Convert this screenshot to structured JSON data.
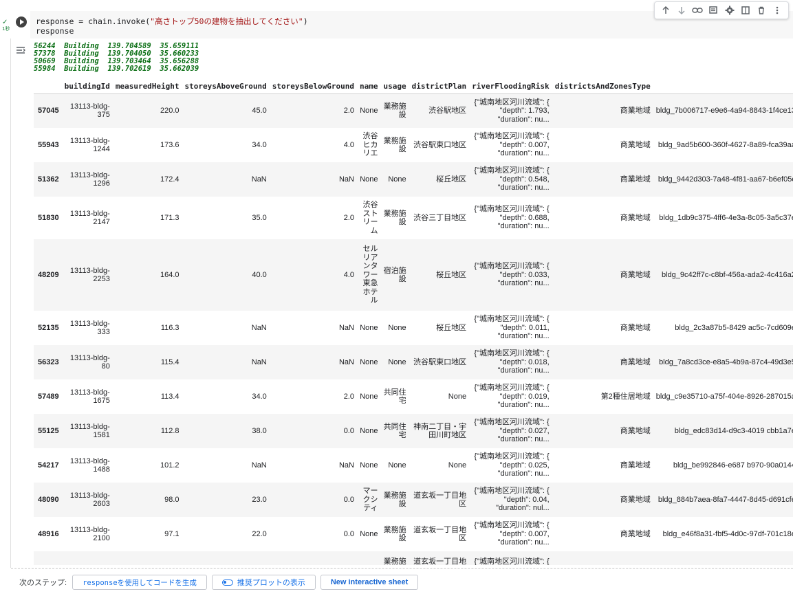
{
  "cell": {
    "status_check": "✓",
    "elapsed": "1秒",
    "code_prefix": "response = chain.invoke(",
    "code_string": "\"高さトップ50の建物を抽出してください\"",
    "code_suffix": ")",
    "code_line2": "response"
  },
  "toolbar": {
    "icons": [
      "arrow-up-icon",
      "arrow-down-icon",
      "link-icon",
      "comment-icon",
      "gear-icon",
      "mirror-icon",
      "trash-icon",
      "more-vert-icon"
    ]
  },
  "log_lines": [
    "56244  Building  139.704589  35.659111",
    "57378  Building  139.704050  35.660233",
    "50669  Building  139.703464  35.656288",
    "55984  Building  139.702619  35.662039"
  ],
  "table": {
    "columns": [
      "",
      "buildingId",
      "measuredHeight",
      "storeysAboveGround",
      "storeysBelowGround",
      "name",
      "usage",
      "districtPlan",
      "riverFloodingRisk",
      "districtsAndZonesType",
      ""
    ],
    "rows": [
      {
        "idx": "57045",
        "bid": "13113-bldg-375",
        "h": "220.0",
        "above": "45.0",
        "below": "2.0",
        "name": "None",
        "usage": "業務施設",
        "dp": "渋谷駅地区",
        "risk": "{\"城南地区河川流域\": { \"depth\": 1.793, \"duration\": nu...",
        "zone": "商業地域",
        "gml": "bldg_7b006717-e9e6-4a94-8843-1f4ce13"
      },
      {
        "idx": "55943",
        "bid": "13113-bldg-1244",
        "h": "173.6",
        "above": "34.0",
        "below": "4.0",
        "name": "渋谷ヒカリエ",
        "usage": "業務施設",
        "dp": "渋谷駅東口地区",
        "risk": "{\"城南地区河川流域\": { \"depth\": 0.007, \"duration\": nu...",
        "zone": "商業地域",
        "gml": "bldg_9ad5b600-360f-4627-8a89-fca39aa"
      },
      {
        "idx": "51362",
        "bid": "13113-bldg-1296",
        "h": "172.4",
        "above": "NaN",
        "below": "NaN",
        "name": "None",
        "usage": "None",
        "dp": "桜丘地区",
        "risk": "{\"城南地区河川流域\": { \"depth\": 0.548, \"duration\": nu...",
        "zone": "商業地域",
        "gml": "bldg_9442d303-7a48-4f81-aa67-b6ef05c"
      },
      {
        "idx": "51830",
        "bid": "13113-bldg-2147",
        "h": "171.3",
        "above": "35.0",
        "below": "2.0",
        "name": "渋谷ストリーム",
        "usage": "業務施設",
        "dp": "渋谷三丁目地区",
        "risk": "{\"城南地区河川流域\": { \"depth\": 0.688, \"duration\": nu...",
        "zone": "商業地域",
        "gml": "bldg_1db9c375-4ff6-4e3a-8c05-3a5c37e"
      },
      {
        "idx": "48209",
        "bid": "13113-bldg-2253",
        "h": "164.0",
        "above": "40.0",
        "below": "4.0",
        "name": "セルリアンタワー東急ホテル",
        "usage": "宿泊施設",
        "dp": "桜丘地区",
        "risk": "{\"城南地区河川流域\": { \"depth\": 0.033, \"duration\": nu...",
        "zone": "商業地域",
        "gml": "bldg_9c42ff7c-c8bf-456a-ada2-4c416a2"
      },
      {
        "idx": "52135",
        "bid": "13113-bldg-333",
        "h": "116.3",
        "above": "NaN",
        "below": "NaN",
        "name": "None",
        "usage": "None",
        "dp": "桜丘地区",
        "risk": "{\"城南地区河川流域\": { \"depth\": 0.011, \"duration\": nu...",
        "zone": "商業地域",
        "gml": "bldg_2c3a87b5-8429 ac5c-7cd609e"
      },
      {
        "idx": "56323",
        "bid": "13113-bldg-80",
        "h": "115.4",
        "above": "NaN",
        "below": "NaN",
        "name": "None",
        "usage": "None",
        "dp": "渋谷駅東口地区",
        "risk": "{\"城南地区河川流域\": { \"depth\": 0.018, \"duration\": nu...",
        "zone": "商業地域",
        "gml": "bldg_7a8cd3ce-e8a5-4b9a-87c4-49d3e5"
      },
      {
        "idx": "57489",
        "bid": "13113-bldg-1675",
        "h": "113.4",
        "above": "34.0",
        "below": "2.0",
        "name": "None",
        "usage": "共同住宅",
        "dp": "None",
        "risk": "{\"城南地区河川流域\": { \"depth\": 0.019, \"duration\": nu...",
        "zone": "第2種住居地域",
        "gml": "bldg_c9e35710-a75f-404e-8926-287015a"
      },
      {
        "idx": "55125",
        "bid": "13113-bldg-1581",
        "h": "112.8",
        "above": "38.0",
        "below": "0.0",
        "name": "None",
        "usage": "共同住宅",
        "dp": "神南二丁目・宇田川町地区",
        "risk": "{\"城南地区河川流域\": { \"depth\": 0.027, \"duration\": nu...",
        "zone": "商業地域",
        "gml": "bldg_edc83d14-d9c3-4019 cbb1a7e"
      },
      {
        "idx": "54217",
        "bid": "13113-bldg-1488",
        "h": "101.2",
        "above": "NaN",
        "below": "NaN",
        "name": "None",
        "usage": "None",
        "dp": "None",
        "risk": "{\"城南地区河川流域\": { \"depth\": 0.025, \"duration\": nu...",
        "zone": "商業地域",
        "gml": "bldg_be992846-e687 b970-90a0144"
      },
      {
        "idx": "48090",
        "bid": "13113-bldg-2603",
        "h": "98.0",
        "above": "23.0",
        "below": "0.0",
        "name": "マークシティ",
        "usage": "業務施設",
        "dp": "道玄坂一丁目地区",
        "risk": "{\"城南地区河川流域\": { \"depth\": 0.04, \"duration\": nul...",
        "zone": "商業地域",
        "gml": "bldg_884b7aea-8fa7-4447-8d45-d691cfe"
      },
      {
        "idx": "48916",
        "bid": "13113-bldg-2100",
        "h": "97.1",
        "above": "22.0",
        "below": "0.0",
        "name": "None",
        "usage": "業務施設",
        "dp": "道玄坂一丁目地区",
        "risk": "{\"城南地区河川流域\": { \"depth\": 0.007, \"duration\": nu...",
        "zone": "商業地域",
        "gml": "bldg_e46f8a31-fbf5-4d0c-97df-701c18e"
      },
      {
        "idx": "",
        "bid": "",
        "h": "",
        "above": "",
        "below": "",
        "name": "",
        "usage": "業務施",
        "dp": "道玄坂一丁目地",
        "risk": "{\"城南地区河川流域\": {",
        "zone": "",
        "gml": ""
      }
    ]
  },
  "footer": {
    "next_label": "次のステップ:",
    "chip1": "responseを使用してコードを生成",
    "chip2": "推奨プロットの表示",
    "chip3": "New interactive sheet"
  }
}
